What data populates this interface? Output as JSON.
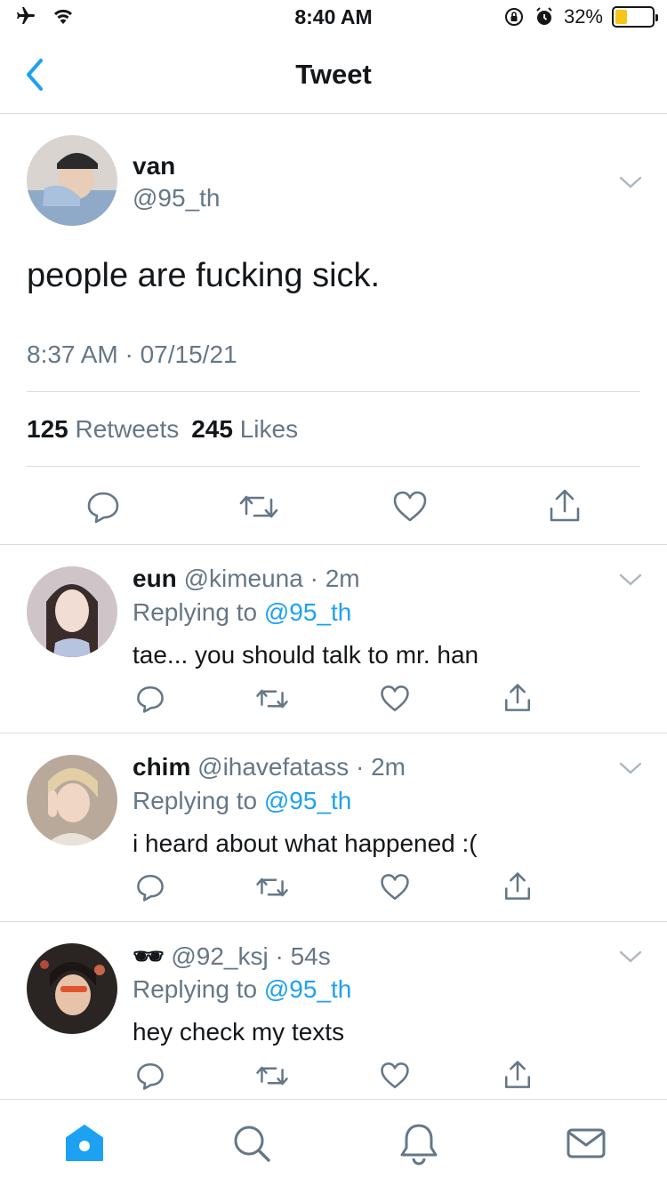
{
  "status_bar": {
    "time": "8:40 AM",
    "battery_text": "32%",
    "battery_level": 0.32,
    "battery_color": "#f5c518"
  },
  "nav": {
    "title": "Tweet",
    "back_icon": "chevron-left-icon"
  },
  "main_tweet": {
    "name": "van",
    "handle": "@95_th",
    "text": "people are fucking sick.",
    "meta": "8:37 AM · 07/15/21",
    "retweet_count": "125",
    "retweet_label": "Retweets",
    "like_count": "245",
    "like_label": "Likes"
  },
  "replies": [
    {
      "name": "eun",
      "handle": "@kimeuna",
      "time": "· 2m",
      "replying_prefix": "Replying to",
      "replying_to": "@95_th",
      "text": "tae... you should talk to mr. han"
    },
    {
      "name": "chim",
      "handle": "@ihavefatass",
      "time": "· 2m",
      "replying_prefix": "Replying to",
      "replying_to": "@95_th",
      "text": "i heard about what happened :("
    },
    {
      "name": "🕶",
      "handle": "@92_ksj",
      "time": "· 54s",
      "replying_prefix": "Replying to",
      "replying_to": "@95_th",
      "text": "hey check my texts"
    }
  ],
  "tab_bar": [
    "home-icon",
    "search-icon",
    "notifications-icon",
    "messages-icon"
  ],
  "colors": {
    "accent": "#1da1f2",
    "secondary_text": "#657786",
    "divider": "#d8dde1"
  }
}
